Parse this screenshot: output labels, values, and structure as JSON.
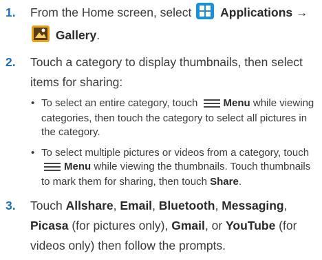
{
  "steps": [
    {
      "num": "1.",
      "pre": "From the Home screen, select",
      "apps_label": "Applications",
      "arrow": "→",
      "gallery_label": "Gallery",
      "end": "."
    },
    {
      "num": "2.",
      "text": "Touch a category to display thumbnails, then select items for sharing:"
    },
    {
      "num": "3.",
      "t1": "Touch ",
      "allshare": "Allshare",
      "c1": ", ",
      "email": "Email",
      "c2": ", ",
      "bluetooth": "Bluetooth",
      "c3": ", ",
      "messaging": "Messaging",
      "c4": ", ",
      "picasa": "Picasa",
      "t2": " (for pictures only), ",
      "gmail": "Gmail",
      "t3": ", or ",
      "youtube": "YouTube",
      "t4": " (for videos only) then follow the prompts."
    }
  ],
  "bullets": [
    {
      "dot": "•",
      "pre": "To select an entire category, touch",
      "menu": "Menu",
      "post": "while viewing categories, then touch the category to select all pictures in the category."
    },
    {
      "dot": "•",
      "pre": "To select multiple pictures or videos from a category, touch",
      "menu": "Menu",
      "post": "while viewing the thumbnails. Touch thumbnails to mark them for sharing, then touch",
      "share": "Share",
      "end": "."
    }
  ],
  "icons": {
    "applications": "applications-grid-icon",
    "gallery": "gallery-icon",
    "menu": "menu-icon"
  },
  "colors": {
    "step_number": "#1b6fb5",
    "apps_icon_bg": "#1c8fd8",
    "gallery_icon_bg": "#e8a21a"
  }
}
